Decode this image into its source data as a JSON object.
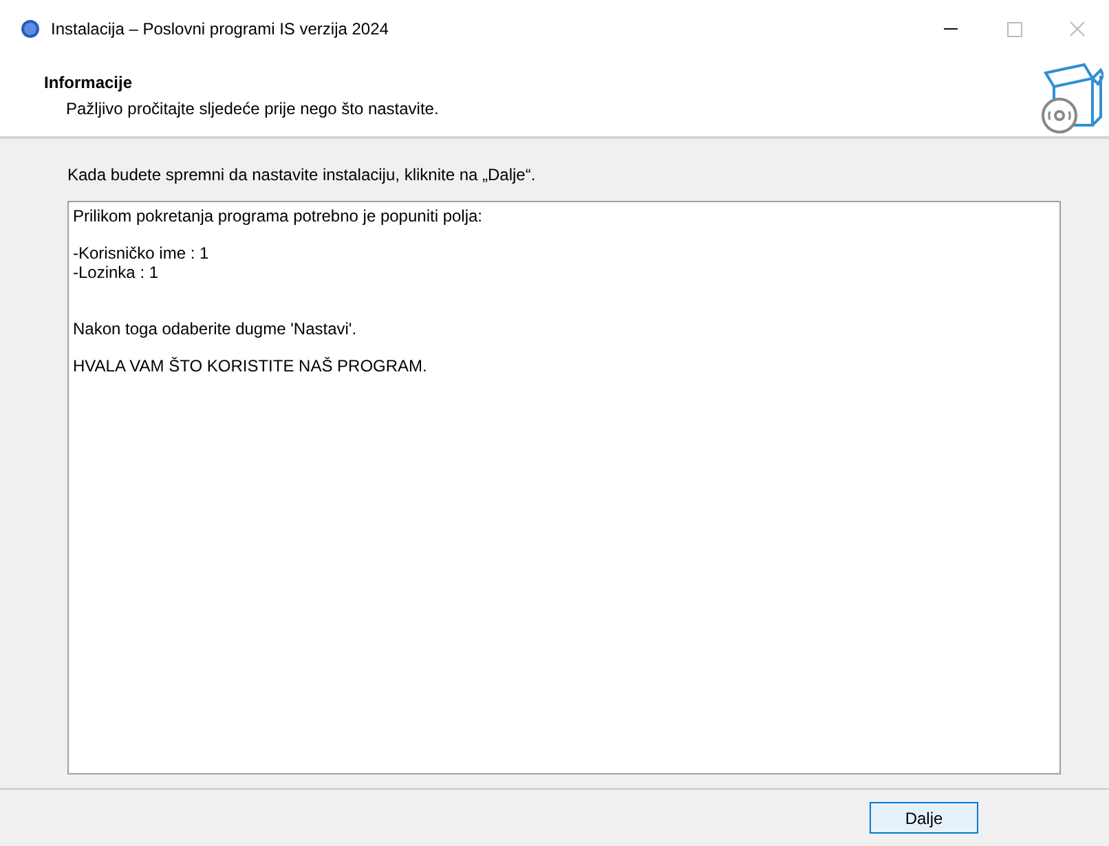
{
  "window": {
    "title": "Instalacija – Poslovni programi IS verzija 2024"
  },
  "header": {
    "title": "Informacije",
    "subtitle": "Pažljivo pročitajte sljedeće prije nego što nastavite."
  },
  "instruction": "Kada budete spremni da nastavite instalaciju, kliknite na „Dalje“.",
  "info_text": [
    [
      "Prilikom pokretanja programa potrebno je popuniti polja:"
    ],
    [
      "-Korisničko ime : 1",
      "-Lozinka : 1"
    ],
    [
      "Nakon toga odaberite dugme 'Nastavi'."
    ],
    [
      "HVALA VAM ŠTO KORISTITE NAŠ PROGRAM."
    ]
  ],
  "buttons": [
    "Dalje"
  ]
}
